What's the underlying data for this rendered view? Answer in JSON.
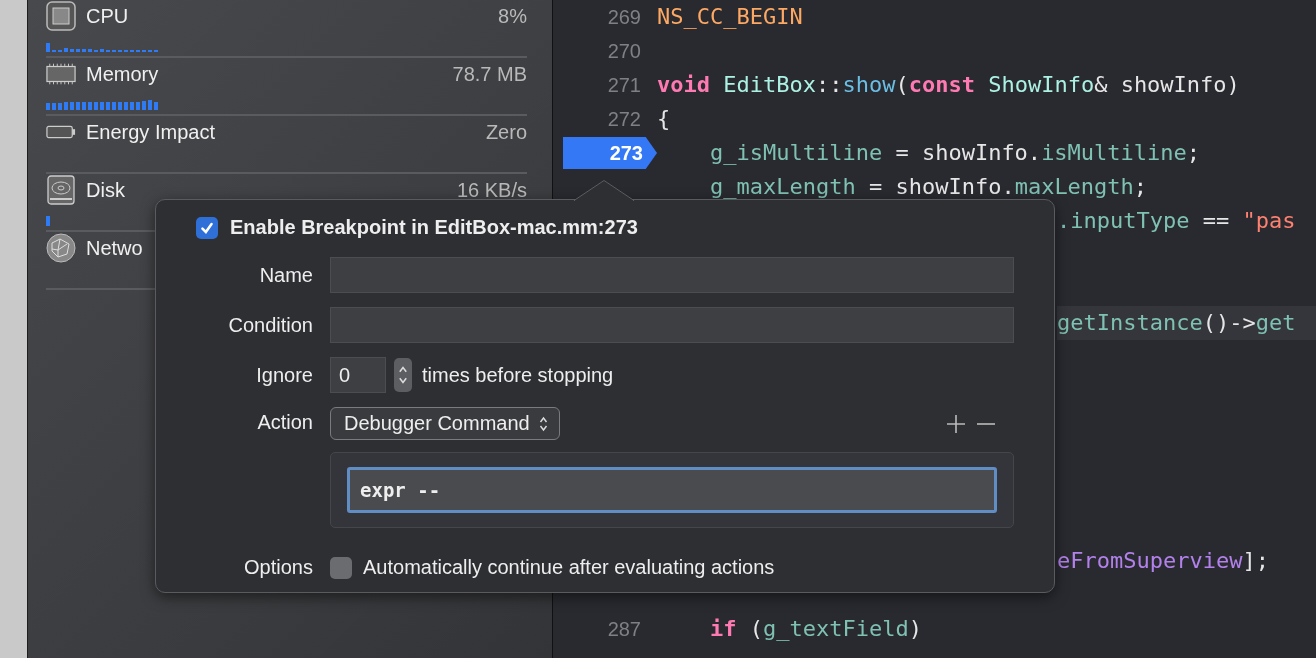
{
  "navigator": {
    "gauges": [
      {
        "kind": "cpu",
        "label": "CPU",
        "value": "8%"
      },
      {
        "kind": "memory",
        "label": "Memory",
        "value": "78.7 MB"
      },
      {
        "kind": "energy",
        "label": "Energy Impact",
        "value": "Zero"
      },
      {
        "kind": "disk",
        "label": "Disk",
        "value": "16 KB/s"
      },
      {
        "kind": "network",
        "label": "Netwo"
      }
    ]
  },
  "editor": {
    "lines": [
      {
        "kind": "code",
        "number": "269",
        "breakpoint": false,
        "tokens": [
          {
            "kind": "macro",
            "text": "NS_CC_BEGIN"
          }
        ]
      },
      {
        "kind": "code",
        "number": "270",
        "breakpoint": false
      },
      {
        "kind": "code",
        "number": "271",
        "breakpoint": false,
        "tokens": [
          {
            "kind": "keyword",
            "text": "void"
          },
          {
            "kind": "type",
            "text": " EditBox"
          },
          {
            "kind": "plain",
            "text": "::"
          },
          {
            "kind": "func",
            "text": "show"
          },
          {
            "kind": "plain",
            "text": "("
          },
          {
            "kind": "keyword",
            "text": "const"
          },
          {
            "kind": "type",
            "text": " ShowInfo"
          },
          {
            "kind": "plain",
            "text": "& showInfo)"
          }
        ]
      },
      {
        "kind": "code",
        "number": "272",
        "breakpoint": false,
        "tokens": [
          {
            "kind": "plain",
            "text": "{"
          }
        ]
      },
      {
        "kind": "code",
        "number": "273",
        "breakpoint": true,
        "tokens": [
          {
            "kind": "member",
            "text": "    g_isMultiline"
          },
          {
            "kind": "plain",
            "text": " = showInfo."
          },
          {
            "kind": "member",
            "text": "isMultiline"
          },
          {
            "kind": "plain",
            "text": ";"
          }
        ]
      },
      {
        "kind": "code",
        "tokens": [
          {
            "kind": "member",
            "text": "    g_maxLength"
          },
          {
            "kind": "plain",
            "text": " = showInfo."
          },
          {
            "kind": "member",
            "text": "maxLength"
          },
          {
            "kind": "plain",
            "text": ";"
          }
        ]
      },
      {
        "kind": "clipped",
        "highlighted": false,
        "tokens": [
          {
            "kind": "member",
            "text": ".inputType"
          },
          {
            "kind": "plain",
            "text": " == "
          },
          {
            "kind": "string",
            "text": "\"pas"
          }
        ]
      },
      {
        "kind": "covered"
      },
      {
        "kind": "covered"
      },
      {
        "kind": "clipped",
        "highlighted": true,
        "tokens": [
          {
            "kind": "member",
            "text": "getInstance"
          },
          {
            "kind": "plain",
            "text": "()->"
          },
          {
            "kind": "member",
            "text": "get"
          }
        ]
      },
      {
        "kind": "covered"
      },
      {
        "kind": "covered"
      },
      {
        "kind": "covered"
      },
      {
        "kind": "covered"
      },
      {
        "kind": "covered"
      },
      {
        "kind": "covered"
      },
      {
        "kind": "clipped",
        "highlighted": false,
        "tokens": [
          {
            "kind": "method",
            "text": "eFromSuperview"
          },
          {
            "kind": "plain",
            "text": "];"
          }
        ]
      },
      {
        "kind": "covered"
      },
      {
        "kind": "code",
        "number": "287",
        "breakpoint": false,
        "tokens": [
          {
            "kind": "keyword",
            "text": "    if"
          },
          {
            "kind": "plain",
            "text": " ("
          },
          {
            "kind": "member",
            "text": "g_textField"
          },
          {
            "kind": "plain",
            "text": ")"
          }
        ]
      }
    ]
  },
  "breakpoint_popover": {
    "enable": {
      "label": "Enable Breakpoint in EditBox-mac.mm:273",
      "checked": true
    },
    "name": {
      "label": "Name"
    },
    "condition": {
      "label": "Condition"
    },
    "ignore": {
      "label": "Ignore",
      "value": "0",
      "suffix": "times before stopping"
    },
    "action": {
      "label": "Action",
      "value": "Debugger Command",
      "command": "expr --"
    },
    "options": {
      "label": "Options",
      "checkbox_label": "Automatically continue after evaluating actions",
      "checked": false
    }
  }
}
